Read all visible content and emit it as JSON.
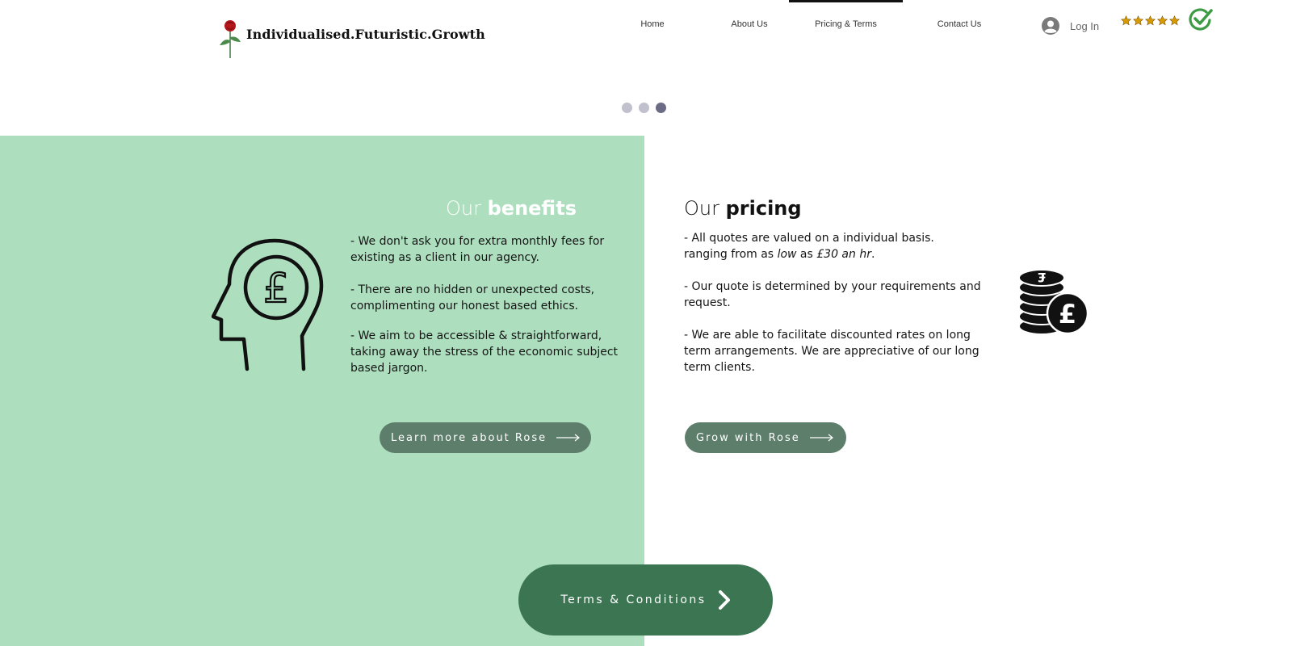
{
  "header": {
    "brand": "Individualised.Futuristic.Growth",
    "nav": [
      {
        "label": "Home"
      },
      {
        "label": "About Us"
      },
      {
        "label": "Pricing & Terms"
      },
      {
        "label": "Contact Us"
      }
    ],
    "active_nav": "Pricing & Terms",
    "login_label": "Log In",
    "rating_stars": 5
  },
  "slider": {
    "dot_count": 3,
    "active_dot": 3
  },
  "benefits": {
    "title_light": "Our",
    "title_bold": "benefits",
    "points": [
      "- We don't ask you for extra monthly fees for existing as a client in our agency.",
      "- There are no hidden or unexpected costs, complimenting our honest based ethics.",
      "- We aim to be accessible & straightforward, taking away the stress of the economic subject based jargon."
    ],
    "button_label": "Learn more about Rose"
  },
  "pricing": {
    "title_light": "Our",
    "title_bold": "pricing",
    "point1_line1": "- All quotes are valued on a individual basis.",
    "point1_prefix": "ranging from as ",
    "point1_low": "low",
    "point1_mid": " as ",
    "point1_price": "£30 an hr",
    "point1_end": ".",
    "points": [
      "- Our quote is determined by your requirements and request.",
      "- We are able to facilitate discounted rates on long term arrangements. We are appreciative of our long term clients."
    ],
    "button_label": "Grow with Rose"
  },
  "terms": {
    "button_label": "Terms & Conditions"
  },
  "colors": {
    "benefits_bg": "#addfbf",
    "button_green": "#5d7e6b",
    "terms_green": "#3b7552",
    "check_green": "#3f9a45",
    "star_gold": "#c79100"
  }
}
